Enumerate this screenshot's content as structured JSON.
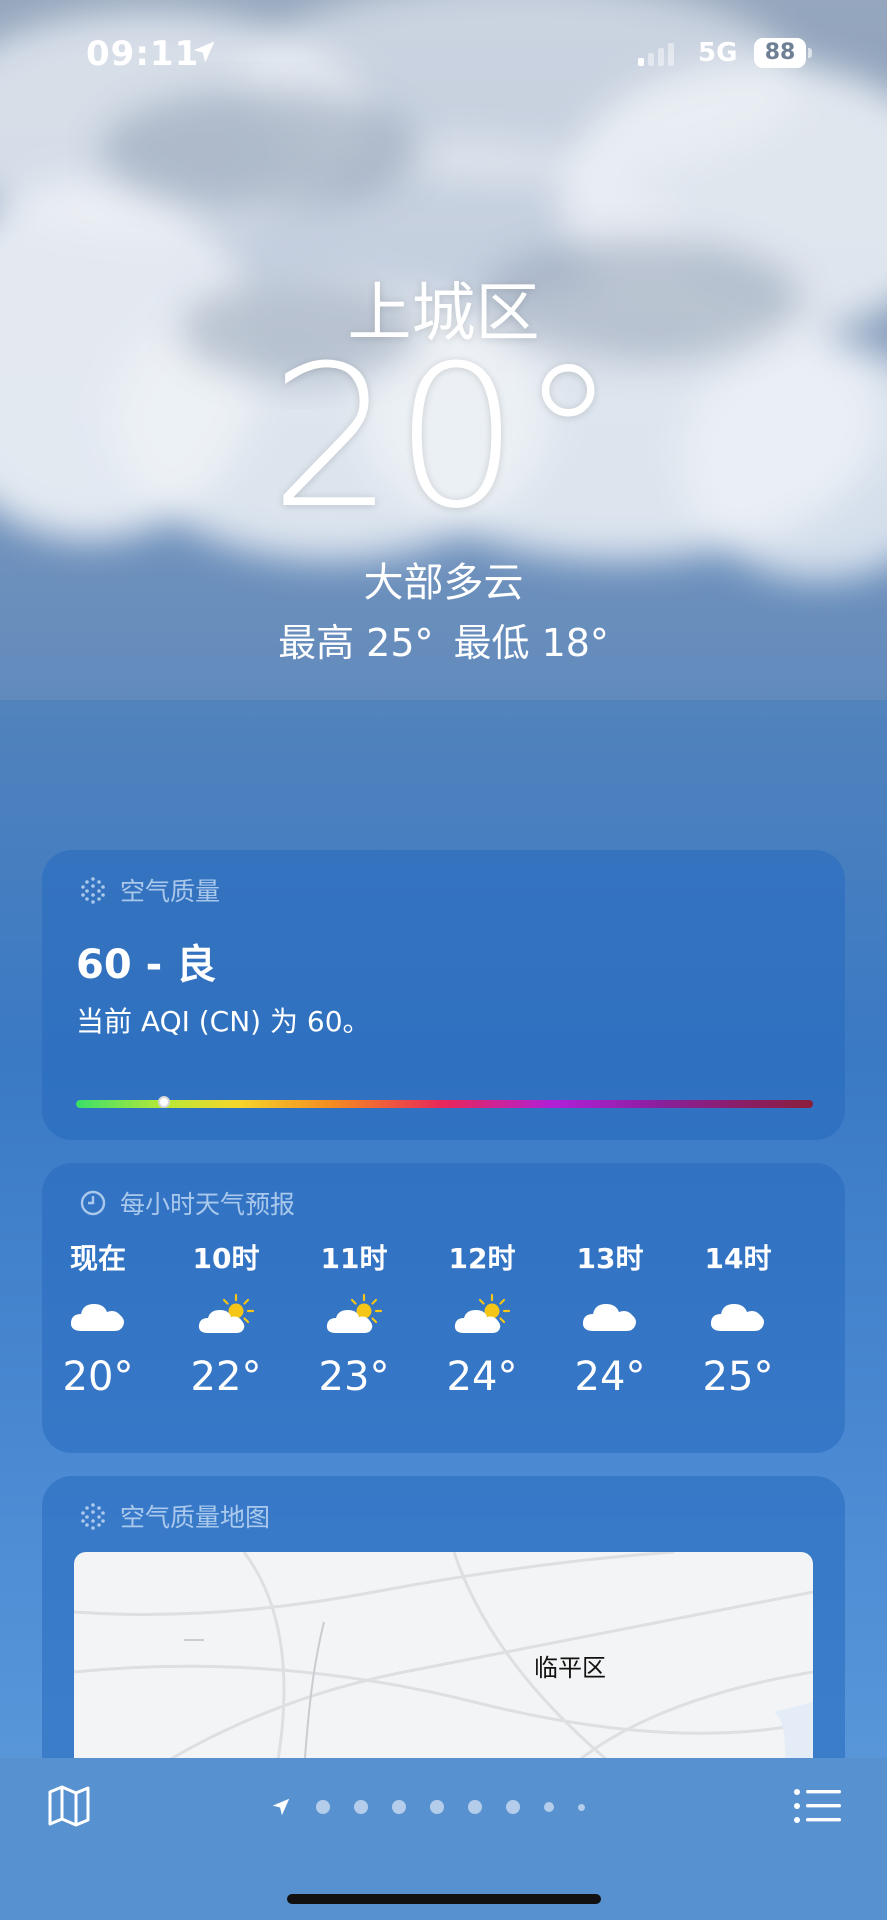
{
  "status_bar": {
    "time": "09:11",
    "network": "5G",
    "battery": "88"
  },
  "location": {
    "city": "上城区",
    "temperature": "20°",
    "condition": "大部多云",
    "high": "最高 25°",
    "low": "最低 18°"
  },
  "air_quality": {
    "title": "空气质量",
    "value": "60 - 良",
    "description": "当前 AQI (CN) 为 60。",
    "level_fraction": 0.12
  },
  "hourly": {
    "title": "每小时天气预报",
    "items": [
      {
        "label": "现在",
        "icon": "cloud-icon",
        "temp": "20°"
      },
      {
        "label": "10时",
        "icon": "partly-sunny-icon",
        "temp": "22°"
      },
      {
        "label": "11时",
        "icon": "partly-sunny-icon",
        "temp": "23°"
      },
      {
        "label": "12时",
        "icon": "partly-sunny-icon",
        "temp": "24°"
      },
      {
        "label": "13时",
        "icon": "cloud-icon",
        "temp": "24°"
      },
      {
        "label": "14时",
        "icon": "cloud-icon",
        "temp": "25°"
      }
    ]
  },
  "aqi_map": {
    "title": "空气质量地图",
    "place_label": "临平区"
  },
  "tab_bar": {
    "map_icon": "map-icon",
    "list_icon": "list-icon",
    "page_count": 9,
    "current_page": "location"
  }
}
